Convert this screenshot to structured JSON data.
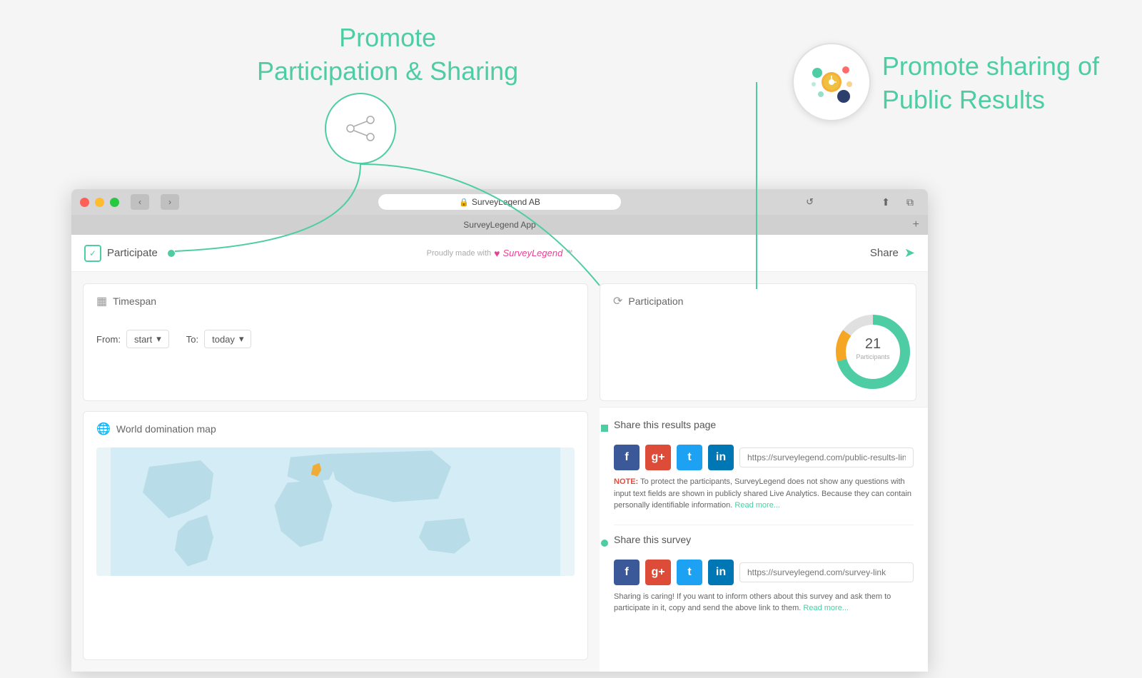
{
  "annotations": {
    "left": {
      "line1": "Promote",
      "line2": "Participation & Sharing"
    },
    "right": {
      "line1": "Promote sharing of",
      "line2": "Public Results"
    }
  },
  "browser": {
    "address": "SurveyLegend AB",
    "tab_title": "SurveyLegend App",
    "new_tab": "+"
  },
  "toolbar": {
    "participate_label": "Participate",
    "proudly_made": "Proudly made with",
    "sl_brand": "SurveyLegend",
    "share_label": "Share"
  },
  "timespan": {
    "title": "Timespan",
    "from_label": "From:",
    "from_value": "start",
    "to_label": "To:",
    "to_value": "today"
  },
  "participation": {
    "title": "Participation",
    "count": "21",
    "label": "Participants"
  },
  "map": {
    "title": "World domination map"
  },
  "share_results": {
    "title": "Share this results page",
    "link_placeholder": "https://surveylegend.com/public-results-link",
    "note_label": "NOTE:",
    "note_text": "To protect the participants, SurveyLegend does not show any questions with input text fields are shown in publicly shared Live Analytics. Because they can contain personally identifiable information.",
    "read_more": "Read more..."
  },
  "share_survey": {
    "title": "Share this survey",
    "link_placeholder": "https://surveylegend.com/survey-link",
    "note_text": "Sharing is caring! If you want to inform others about this survey and ask them to participate in it, copy and send the above link to them.",
    "read_more": "Read more..."
  },
  "social_buttons": [
    "f",
    "g+",
    "t",
    "in"
  ]
}
